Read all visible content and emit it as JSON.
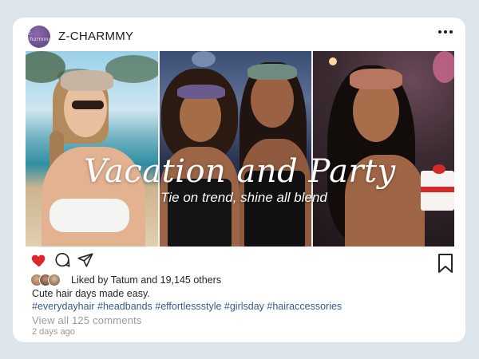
{
  "post": {
    "username": "Z-CHARMMY",
    "avatar_text": "Z-charmmy",
    "more_icon": "more-horizontal-icon",
    "image": {
      "title": "Vacation and Party",
      "subtitle": "Tie on trend, shine all blend"
    },
    "actions": {
      "like_icon": "heart-filled-icon",
      "like_color": "#e0242f",
      "comment_icon": "comment-icon",
      "share_icon": "paper-plane-icon",
      "save_icon": "bookmark-icon"
    },
    "likes_text": "Liked by Tatum and 19,145 others",
    "caption": "Cute hair days made easy.",
    "hashtags": "#everydayhair #headbands #effortlessstyle #girlsday #hairaccessories",
    "view_comments": "View all 125 comments",
    "time_ago": "2 days ago"
  },
  "colors": {
    "background": "#dde5ec",
    "card": "#ffffff",
    "hashtag": "#3a5a8c",
    "muted": "#9a9a9a"
  }
}
